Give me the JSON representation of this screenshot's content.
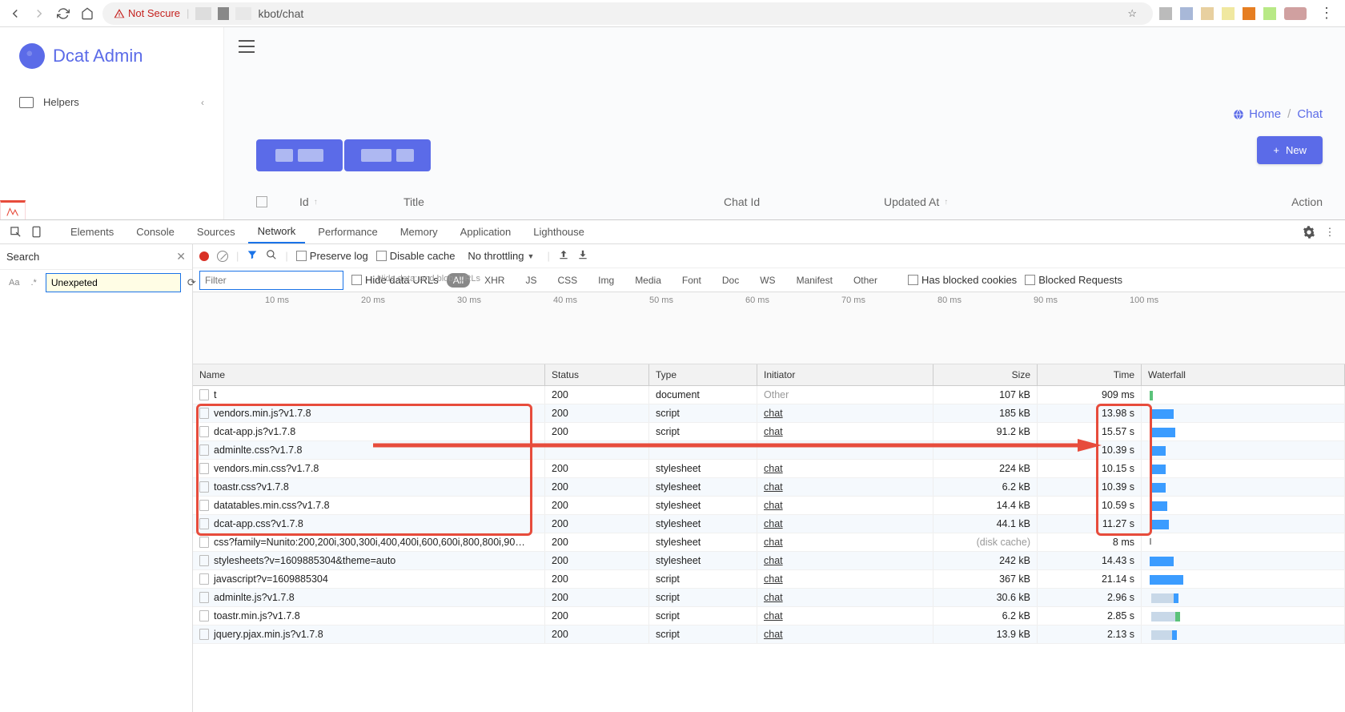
{
  "browser": {
    "not_secure": "Not Secure",
    "url": "kbot/chat"
  },
  "admin": {
    "brand": "Dcat Admin",
    "sidebar": {
      "helpers": "Helpers"
    },
    "breadcrumb": {
      "home": "Home",
      "current": "Chat"
    },
    "new_button": "New",
    "table": {
      "id": "Id",
      "title": "Title",
      "chat_id": "Chat Id",
      "updated_at": "Updated At",
      "action": "Action"
    }
  },
  "devtools": {
    "tabs": [
      "Elements",
      "Console",
      "Sources",
      "Network",
      "Performance",
      "Memory",
      "Application",
      "Lighthouse"
    ],
    "active_tab": "Network",
    "search_label": "Search",
    "find_value": "Unexpeted",
    "toolbar": {
      "preserve_log": "Preserve log",
      "disable_cache": "Disable cache",
      "throttling": "No throttling"
    },
    "filter": {
      "placeholder": "Filter",
      "hide_data_urls": "Hide data URLs",
      "hint": "Hide data: and blob: URLs",
      "types": [
        "All",
        "XHR",
        "JS",
        "CSS",
        "Img",
        "Media",
        "Font",
        "Doc",
        "WS",
        "Manifest",
        "Other"
      ],
      "has_blocked_cookies": "Has blocked cookies",
      "blocked_requests": "Blocked Requests"
    },
    "timeline_ticks": [
      "10 ms",
      "20 ms",
      "30 ms",
      "40 ms",
      "50 ms",
      "60 ms",
      "70 ms",
      "80 ms",
      "90 ms",
      "100 ms"
    ],
    "columns": {
      "name": "Name",
      "status": "Status",
      "type": "Type",
      "initiator": "Initiator",
      "size": "Size",
      "time": "Time",
      "waterfall": "Waterfall"
    },
    "rows": [
      {
        "name": "t",
        "status": "200",
        "type": "document",
        "initiator": "Other",
        "init_link": false,
        "size": "107 kB",
        "time": "909 ms",
        "wf_style": "tiny-green"
      },
      {
        "name": "vendors.min.js?v1.7.8",
        "status": "200",
        "type": "script",
        "initiator": "chat",
        "init_link": true,
        "size": "185 kB",
        "time": "13.98 s",
        "wf_style": "blue-30"
      },
      {
        "name": "dcat-app.js?v1.7.8",
        "status": "200",
        "type": "script",
        "initiator": "chat",
        "init_link": true,
        "size": "91.2 kB",
        "time": "15.57 s",
        "wf_style": "blue-32"
      },
      {
        "name": "adminlte.css?v1.7.8",
        "status": "",
        "type": "",
        "initiator": "",
        "init_link": true,
        "size": "",
        "time": "10.39 s",
        "wf_style": "blue-20"
      },
      {
        "name": "vendors.min.css?v1.7.8",
        "status": "200",
        "type": "stylesheet",
        "initiator": "chat",
        "init_link": true,
        "size": "224 kB",
        "time": "10.15 s",
        "wf_style": "blue-20"
      },
      {
        "name": "toastr.css?v1.7.8",
        "status": "200",
        "type": "stylesheet",
        "initiator": "chat",
        "init_link": true,
        "size": "6.2 kB",
        "time": "10.39 s",
        "wf_style": "blue-20"
      },
      {
        "name": "datatables.min.css?v1.7.8",
        "status": "200",
        "type": "stylesheet",
        "initiator": "chat",
        "init_link": true,
        "size": "14.4 kB",
        "time": "10.59 s",
        "wf_style": "blue-22"
      },
      {
        "name": "dcat-app.css?v1.7.8",
        "status": "200",
        "type": "stylesheet",
        "initiator": "chat",
        "init_link": true,
        "size": "44.1 kB",
        "time": "11.27 s",
        "wf_style": "blue-24"
      },
      {
        "name": "css?family=Nunito:200,200i,300,300i,400,400i,600,600i,800,800i,90…",
        "status": "200",
        "type": "stylesheet",
        "initiator": "chat",
        "init_link": true,
        "size": "(disk cache)",
        "size_cache": true,
        "time": "8 ms",
        "wf_style": "tiny"
      },
      {
        "name": "stylesheets?v=1609885304&theme=auto",
        "status": "200",
        "type": "stylesheet",
        "initiator": "chat",
        "init_link": true,
        "size": "242 kB",
        "time": "14.43 s",
        "wf_style": "blue-30"
      },
      {
        "name": "javascript?v=1609885304",
        "status": "200",
        "type": "script",
        "initiator": "chat",
        "init_link": true,
        "size": "367 kB",
        "time": "21.14 s",
        "wf_style": "blue-42"
      },
      {
        "name": "adminlte.js?v1.7.8",
        "status": "200",
        "type": "script",
        "initiator": "chat",
        "init_link": true,
        "size": "30.6 kB",
        "time": "2.96 s",
        "wf_style": "split-a"
      },
      {
        "name": "toastr.min.js?v1.7.8",
        "status": "200",
        "type": "script",
        "initiator": "chat",
        "init_link": true,
        "size": "6.2 kB",
        "time": "2.85 s",
        "wf_style": "split-b"
      },
      {
        "name": "jquery.pjax.min.js?v1.7.8",
        "status": "200",
        "type": "script",
        "initiator": "chat",
        "init_link": true,
        "size": "13.9 kB",
        "time": "2.13 s",
        "wf_style": "split-c"
      }
    ]
  }
}
